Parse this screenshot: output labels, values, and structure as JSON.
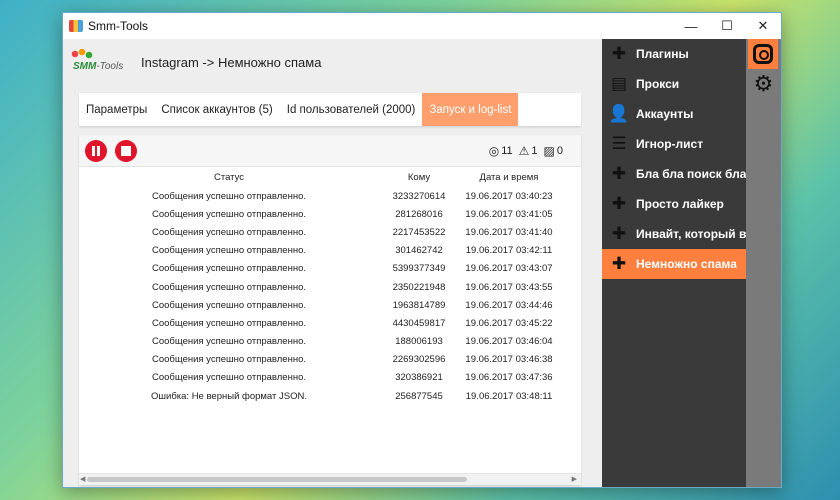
{
  "window": {
    "title": "Smm-Tools",
    "minimize": "—",
    "maximize": "☐",
    "close": "✕"
  },
  "logo": {
    "text1": "SMM",
    "text2": "-Tools"
  },
  "breadcrumb": "Instagram -> Немножно спама",
  "tabs": [
    {
      "label": "Параметры"
    },
    {
      "label": "Список аккаунтов (5)"
    },
    {
      "label": "Id пользователей (2000)"
    },
    {
      "label": "Запуск и log-list"
    }
  ],
  "stats": {
    "success": "11",
    "warnings": "1",
    "images": "0"
  },
  "table": {
    "headers": [
      "Статус",
      "Кому",
      "Дата и время"
    ],
    "rows": [
      [
        "Сообщения успешно отправленно.",
        "3233270614",
        "19.06.2017 03:40:23"
      ],
      [
        "Сообщения успешно отправленно.",
        "281268016",
        "19.06.2017 03:41:05"
      ],
      [
        "Сообщения успешно отправленно.",
        "2217453522",
        "19.06.2017 03:41:40"
      ],
      [
        "Сообщения успешно отправленно.",
        "301462742",
        "19.06.2017 03:42:11"
      ],
      [
        "Сообщения успешно отправленно.",
        "5399377349",
        "19.06.2017 03:43:07"
      ],
      [
        "Сообщения успешно отправленно.",
        "2350221948",
        "19.06.2017 03:43:55"
      ],
      [
        "Сообщения успешно отправленно.",
        "1963814789",
        "19.06.2017 03:44:46"
      ],
      [
        "Сообщения успешно отправленно.",
        "4430459817",
        "19.06.2017 03:45:22"
      ],
      [
        "Сообщения успешно отправленно.",
        "188006193",
        "19.06.2017 03:46:04"
      ],
      [
        "Сообщения успешно отправленно.",
        "2269302596",
        "19.06.2017 03:46:38"
      ],
      [
        "Сообщения успешно отправленно.",
        "320386921",
        "19.06.2017 03:47:36"
      ],
      [
        "Ошибка: Не верный формат JSON.",
        "256877545",
        "19.06.2017 03:48:11"
      ]
    ]
  },
  "sidebar": {
    "items": [
      {
        "label": "Плагины",
        "icon": "puzzle-icon"
      },
      {
        "label": "Прокси",
        "icon": "server-icon"
      },
      {
        "label": "Аккаунты",
        "icon": "user-add-icon"
      },
      {
        "label": "Игнор-лист",
        "icon": "list-icon"
      },
      {
        "label": "Бла бла поиск бла",
        "icon": "puzzle-icon"
      },
      {
        "label": "Просто лайкер",
        "icon": "puzzle-icon"
      },
      {
        "label": "Инвайт, который в",
        "icon": "puzzle-icon"
      },
      {
        "label": "Немножно спама",
        "icon": "puzzle-icon"
      }
    ],
    "active_index": 7
  },
  "colors": {
    "accent": "#ff7f3f",
    "tab_active": "#ff9f6e",
    "control_red": "#e0142a",
    "sidebar_bg": "#3a3a3a",
    "rail_bg": "#7a7a7a"
  }
}
